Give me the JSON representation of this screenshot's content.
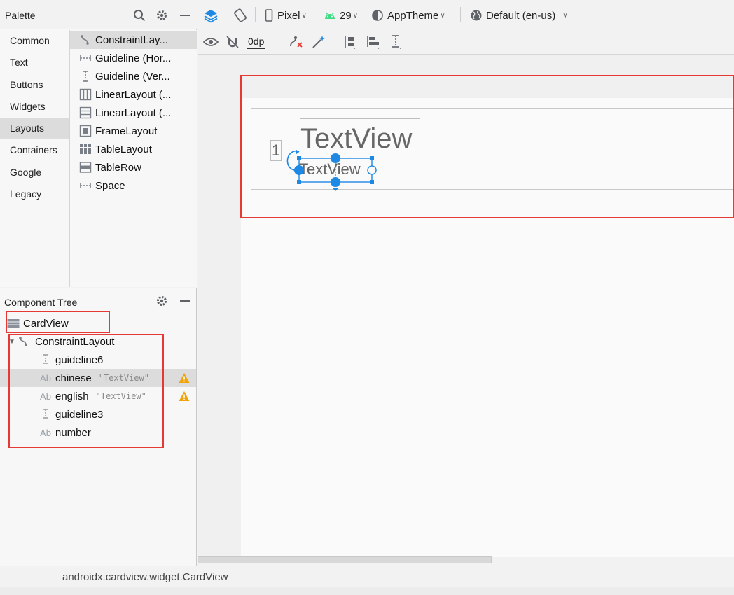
{
  "palette": {
    "title": "Palette",
    "categories": [
      "Common",
      "Text",
      "Buttons",
      "Widgets",
      "Layouts",
      "Containers",
      "Google",
      "Legacy"
    ],
    "active_category": "Layouts",
    "widgets": [
      "ConstraintLay...",
      "Guideline (Hor...",
      "Guideline (Ver...",
      "LinearLayout (...",
      "LinearLayout (...",
      "FrameLayout",
      "TableLayout",
      "TableRow",
      "Space"
    ]
  },
  "toolbar": {
    "device": "Pixel",
    "api": "29",
    "theme": "AppTheme",
    "locale": "Default (en-us)",
    "margin": "0dp"
  },
  "design": {
    "textview_large": "TextView",
    "textview_small": "TextView",
    "number_text": "1"
  },
  "component_tree": {
    "title": "Component Tree",
    "root": "CardView",
    "layout": "ConstraintLayout",
    "items": [
      {
        "name": "guideline6",
        "tag": "",
        "icon": "guideline-vertical-icon",
        "warning": false
      },
      {
        "name": "chinese",
        "tag": "\"TextView\"",
        "icon": "textview-icon",
        "warning": true
      },
      {
        "name": "english",
        "tag": "\"TextView\"",
        "icon": "textview-icon",
        "warning": true
      },
      {
        "name": "guideline3",
        "tag": "",
        "icon": "guideline-vertical-icon",
        "warning": false
      },
      {
        "name": "number",
        "tag": "",
        "icon": "textview-icon",
        "warning": false
      }
    ]
  },
  "status": {
    "selected_class": "androidx.cardview.widget.CardView"
  },
  "colors": {
    "highlight_red": "#e53935",
    "selection_blue": "#1e88e5",
    "warning": "#f0a30a"
  }
}
